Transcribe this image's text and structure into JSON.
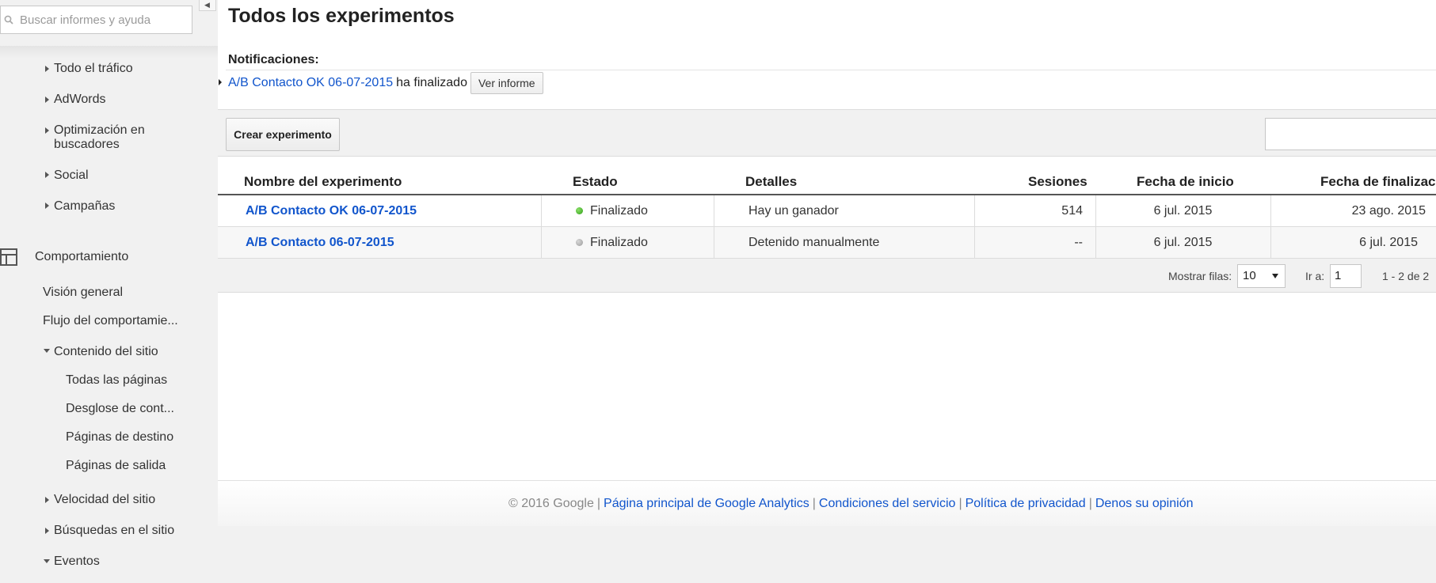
{
  "search": {
    "placeholder": "Buscar informes y ayuda"
  },
  "sidebar": {
    "acquisition_items": [
      {
        "label": "Todo el tráfico"
      },
      {
        "label": "AdWords"
      },
      {
        "label": "Optimización en",
        "label2": "buscadores"
      },
      {
        "label": "Social"
      },
      {
        "label": "Campañas"
      }
    ],
    "behaviour": {
      "label": "Comportamiento",
      "items": {
        "overview": "Visión general",
        "flow": "Flujo del comportamie...",
        "site_content": "Contenido del sitio",
        "all_pages": "Todas las páginas",
        "content_drilldown": "Desglose de cont...",
        "landing_pages": "Páginas de destino",
        "exit_pages": "Páginas de salida",
        "site_speed": "Velocidad del sitio",
        "site_search": "Búsquedas en el sitio",
        "events": "Eventos"
      }
    }
  },
  "main": {
    "title": "Todos los experimentos",
    "notifications": {
      "label": "Notificaciones:",
      "link": "A/B Contacto OK 06-07-2015",
      "text": "ha finalizado",
      "button": "Ver informe"
    },
    "toolbar": {
      "create_button": "Crear experimento"
    },
    "table": {
      "headers": {
        "name": "Nombre del experimento",
        "status": "Estado",
        "details": "Detalles",
        "sessions": "Sesiones",
        "start": "Fecha de inicio",
        "end": "Fecha de finalizació"
      },
      "rows": [
        {
          "name": "A/B Contacto OK 06-07-2015",
          "status": "Finalizado",
          "status_color": "#3aa61c",
          "details": "Hay un ganador",
          "sessions": "514",
          "start": "6 jul. 2015",
          "end": "23 ago. 2015"
        },
        {
          "name": "A/B Contacto 06-07-2015",
          "status": "Finalizado",
          "status_color": "#a8a8a8",
          "details": "Detenido manualmente",
          "sessions": "--",
          "start": "6 jul. 2015",
          "end": "6 jul. 2015"
        }
      ],
      "footer": {
        "rows_label": "Mostrar filas:",
        "rows_value": "10",
        "goto_label": "Ir a:",
        "goto_value": "1",
        "range": "1 - 2 de 2"
      }
    },
    "footer": {
      "copyright": "© 2016 Google",
      "links": [
        "Página principal de Google Analytics",
        "Condiciones del servicio",
        "Política de privacidad",
        "Denos su opinión"
      ]
    }
  }
}
